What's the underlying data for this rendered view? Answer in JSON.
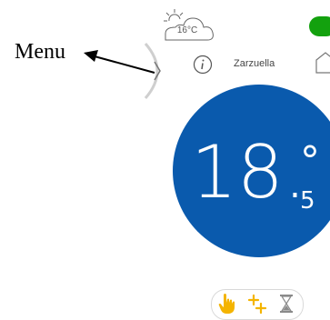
{
  "annotation": {
    "label": "Menu"
  },
  "weather": {
    "temperature": "16°C",
    "icon": "cloud-sun-icon"
  },
  "header": {
    "location": "Zarzuella",
    "toggle_state": "on",
    "toggle_color": "#13a10e"
  },
  "thermostat": {
    "value_main": "18.",
    "degree": "°",
    "value_decimal": "5",
    "circle_color": "#0a5aad"
  },
  "modes": [
    {
      "icon": "hand-icon",
      "color": "#f4b400"
    },
    {
      "icon": "plus-icon",
      "color": "#f4b400"
    },
    {
      "icon": "hourglass-icon",
      "color": "#8a8a8a"
    }
  ]
}
